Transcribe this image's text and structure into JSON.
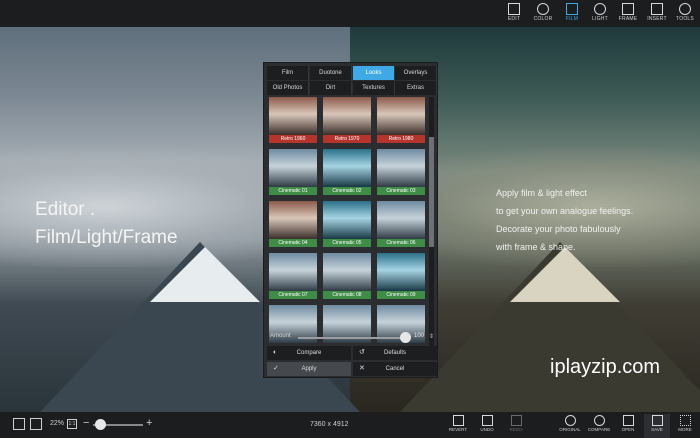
{
  "toolbar": {
    "items": [
      {
        "label": "EDIT",
        "icon": "edit-icon"
      },
      {
        "label": "COLOR",
        "icon": "color-icon"
      },
      {
        "label": "FILM",
        "icon": "film-icon",
        "active": true
      },
      {
        "label": "LIGHT",
        "icon": "light-icon"
      },
      {
        "label": "FRAME",
        "icon": "frame-icon"
      },
      {
        "label": "INSERT",
        "icon": "insert-icon"
      },
      {
        "label": "TOOLS",
        "icon": "tools-icon"
      }
    ]
  },
  "overlay": {
    "headline_1": "Editor .",
    "headline_2": "Film/Light/Frame",
    "desc_lines": [
      "Apply film & light effect",
      "to get your own analogue feelings.",
      "Decorate your photo fabulously",
      "with frame & shape."
    ],
    "watermark": "iplayzip.com"
  },
  "panel": {
    "tabs_row1": [
      "Film",
      "Duotone",
      "Looks",
      "Overlays"
    ],
    "tabs_row2": [
      "Old Photos",
      "Dirt",
      "Textures",
      "Extras"
    ],
    "active_tab": "Looks",
    "thumbnails": [
      {
        "label": "Retro 1960",
        "tag": "red"
      },
      {
        "label": "Retro 1970",
        "tag": "red"
      },
      {
        "label": "Retro 1980",
        "tag": "red"
      },
      {
        "label": "Cinematic 01",
        "tag": "green"
      },
      {
        "label": "Cinematic 02",
        "tag": "green"
      },
      {
        "label": "Cinematic 03",
        "tag": "green"
      },
      {
        "label": "Cinematic 04",
        "tag": "green"
      },
      {
        "label": "Cinematic 05",
        "tag": "green"
      },
      {
        "label": "Cinematic 06",
        "tag": "green"
      },
      {
        "label": "Cinematic 07",
        "tag": "green"
      },
      {
        "label": "Cinematic 08",
        "tag": "green"
      },
      {
        "label": "Cinematic 09",
        "tag": "green"
      },
      {
        "label": "",
        "tag": "none"
      },
      {
        "label": "",
        "tag": "none"
      },
      {
        "label": "",
        "tag": "none"
      }
    ],
    "amount_label": "Amount",
    "amount_value": "100",
    "compare_label": "Compare",
    "defaults_label": "Defaults",
    "apply_label": "Apply",
    "cancel_label": "Cancel"
  },
  "bottombar": {
    "zoom": "22%",
    "zoom_box": "1:1",
    "minus": "−",
    "plus": "+",
    "dimensions": "7360 x 4912",
    "tools": [
      {
        "label": "REVERT",
        "icon": "revert-icon",
        "dim": false
      },
      {
        "label": "UNDO",
        "icon": "undo-icon",
        "dim": false
      },
      {
        "label": "REDO",
        "icon": "redo-icon",
        "dim": true
      },
      {
        "label": "ORIGINAL",
        "icon": "original-icon",
        "dim": false
      },
      {
        "label": "COMPARE",
        "icon": "compare-icon",
        "dim": false
      },
      {
        "label": "OPEN",
        "icon": "open-icon",
        "dim": false
      },
      {
        "label": "SAVE",
        "icon": "save-icon",
        "dim": false
      },
      {
        "label": "MORE",
        "icon": "more-icon",
        "dim": false
      }
    ]
  },
  "colors": {
    "accent": "#3fa9e6",
    "tag_red": "#b5352d",
    "tag_green": "#3f8c46"
  }
}
